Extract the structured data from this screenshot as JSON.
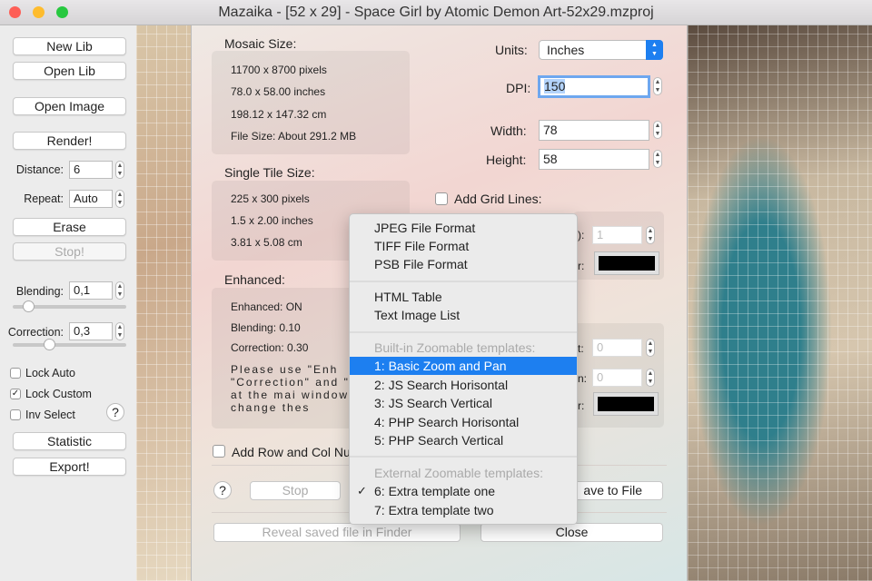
{
  "window": {
    "title": "Mazaika - [52 x 29] - Space Girl by Atomic Demon Art-52x29.mzproj"
  },
  "sidebar": {
    "new_lib": "New Lib",
    "open_lib": "Open Lib",
    "open_image": "Open Image",
    "render": "Render!",
    "distance_label": "Distance:",
    "distance_value": "6",
    "repeat_label": "Repeat:",
    "repeat_value": "Auto",
    "erase": "Erase",
    "stop": "Stop!",
    "blending_label": "Blending:",
    "blending_value": "0,1",
    "blending_slider": 0.1,
    "correction_label": "Correction:",
    "correction_value": "0,3",
    "correction_slider": 0.3,
    "lock_auto": "Lock Auto",
    "lock_auto_checked": false,
    "lock_custom": "Lock Custom",
    "lock_custom_checked": true,
    "inv_select": "Inv Select",
    "inv_select_checked": false,
    "help": "?",
    "statistic": "Statistic",
    "export": "Export!"
  },
  "dialog": {
    "mosaic_size_title": "Mosaic Size:",
    "mosaic_size": [
      "11700 x 8700 pixels",
      "78.0 x 58.00 inches",
      "198.12 x 147.32 cm",
      "File Size: About 291.2 MB"
    ],
    "tile_size_title": "Single Tile Size:",
    "tile_size": [
      "225 x 300 pixels",
      "1.5 x 2.00 inches",
      "3.81 x 5.08 cm"
    ],
    "enhanced_title": "Enhanced:",
    "enhanced": [
      "Enhanced: ON",
      "Blending: 0.10",
      "Correction: 0.30"
    ],
    "enhanced_note": "Please use \"Enh \"Correction\" and \" controls at the mai window to change thes",
    "units_label": "Units:",
    "units_value": "Inches",
    "dpi_label": "DPI:",
    "dpi_value": "150",
    "width_label": "Width:",
    "width_value": "78",
    "height_label": "Height:",
    "height_value": "58",
    "grid_lines_label": "Add Grid Lines:",
    "grid_partial_labels": [
      "):",
      "r:",
      "t:",
      "n:",
      "r:"
    ],
    "grid_width_value": "1",
    "offset_values": [
      "0",
      "0"
    ],
    "row_col_label": "Add Row and Col Nu",
    "help": "?",
    "stop": "Stop",
    "save": "ave to File",
    "reveal": "Reveal saved file in Finder",
    "close": "Close"
  },
  "menu": {
    "items": [
      {
        "label": "JPEG File Format"
      },
      {
        "label": "TIFF File Format"
      },
      {
        "label": "PSB File Format"
      },
      {
        "label": "HTML Table"
      },
      {
        "label": "Text Image List"
      },
      {
        "label": "Built-in Zoomable templates:"
      },
      {
        "label": "1: Basic Zoom and Pan"
      },
      {
        "label": "2: JS Search Horisontal"
      },
      {
        "label": "3: JS Search Vertical"
      },
      {
        "label": "4: PHP Search Horisontal"
      },
      {
        "label": "5: PHP Search Vertical"
      },
      {
        "label": "External Zoomable templates:"
      },
      {
        "label": "6: Extra template one"
      },
      {
        "label": "7: Extra template two"
      }
    ],
    "checkmark": "✓"
  },
  "colors": {
    "accent": "#1d7ff0",
    "close": "#fe5f57",
    "minimize": "#febc2e",
    "zoom": "#28c840"
  }
}
